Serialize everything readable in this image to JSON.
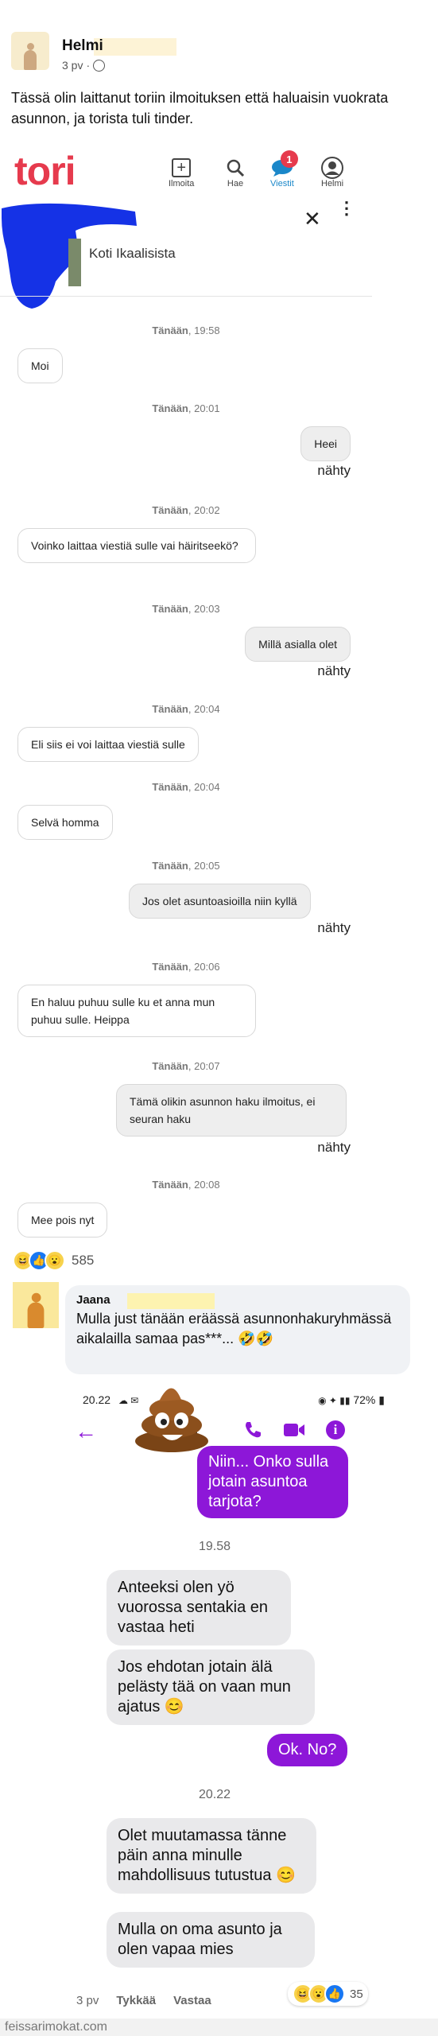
{
  "post": {
    "author": "Helmi",
    "time": "3 pv",
    "text": "Tässä olin laittanut toriin ilmoituksen että haluaisin vuokrata asunnon, ja torista tuli tinder.",
    "reaction_count": "585"
  },
  "tori": {
    "logo": "tori",
    "nav": {
      "ilmoita": "Ilmoita",
      "hae": "Hae",
      "viestit": "Viestit",
      "profile": "Helmi",
      "badge": "1"
    },
    "listing_title": "Koti Ikaalisista",
    "seen": "nähty",
    "messages": [
      {
        "ts_day": "Tänään",
        "ts_time": ", 19:58",
        "side": "left",
        "text": "Moi"
      },
      {
        "ts_day": "Tänään",
        "ts_time": ", 20:01",
        "side": "right",
        "text": "Heei"
      },
      {
        "ts_day": "Tänään",
        "ts_time": ", 20:02",
        "side": "left",
        "text": "Voinko laittaa viestiä sulle vai häiritseekö?"
      },
      {
        "ts_day": "Tänään",
        "ts_time": ", 20:03",
        "side": "right",
        "text": "Millä asialla olet"
      },
      {
        "ts_day": "Tänään",
        "ts_time": ", 20:04",
        "side": "left",
        "text": "Eli siis ei voi laittaa viestiä sulle"
      },
      {
        "ts_day": "Tänään",
        "ts_time": ", 20:04",
        "side": "left",
        "text": "Selvä homma"
      },
      {
        "ts_day": "Tänään",
        "ts_time": ", 20:05",
        "side": "right",
        "text": "Jos olet asuntoasioilla niin kyllä"
      },
      {
        "ts_day": "Tänään",
        "ts_time": ", 20:06",
        "side": "left",
        "text": "En haluu puhuu sulle ku et anna mun puhuu sulle. Heippa"
      },
      {
        "ts_day": "Tänään",
        "ts_time": ", 20:07",
        "side": "right",
        "text": "Tämä olikin asunnon haku ilmoitus, ei seuran haku"
      },
      {
        "ts_day": "Tänään",
        "ts_time": ", 20:08",
        "side": "left",
        "text": "Mee pois nyt"
      }
    ]
  },
  "comment": {
    "author": "Jaana",
    "text": "Mulla just tänään eräässä asunnonhakuryhmässä aikalailla samaa pas***... 🤣🤣",
    "time": "3 pv",
    "like": "Tykkää",
    "reply": "Vastaa",
    "reaction_count": "35"
  },
  "messenger": {
    "status_time": "20.22",
    "status_right": "72%",
    "contact_suffix": "d",
    "messages": [
      {
        "side": "right",
        "text": "Niin... Onko sulla jotain asuntoa tarjota?"
      },
      {
        "ts": "19.58"
      },
      {
        "side": "left",
        "text": "Anteeksi olen yö vuorossa sentakia en vastaa heti"
      },
      {
        "side": "left",
        "text": "Jos ehdotan jotain älä pelästy tää on vaan mun ajatus 😊"
      },
      {
        "side": "right",
        "text": "Ok. No?"
      },
      {
        "ts": "20.22"
      },
      {
        "side": "left",
        "text": "Olet muutamassa tänne päin anna minulle mahdollisuus tutustua 😊"
      },
      {
        "side": "left",
        "text": "Mulla on oma asunto ja olen vapaa mies"
      }
    ]
  },
  "watermark": "feissarimokat.com",
  "colors": {
    "tori_red": "#e63a4d",
    "messenger_purple": "#8d17d8",
    "scribble_blue": "#1532e6"
  }
}
